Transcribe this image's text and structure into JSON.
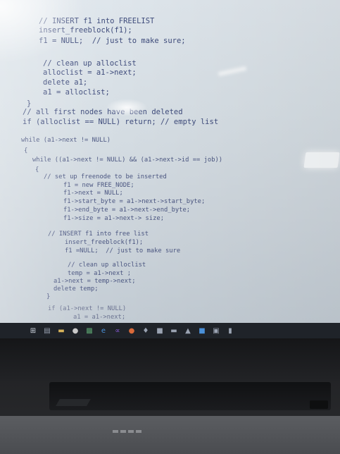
{
  "code_lines": [
    "// INSERT f1 into FREELIST",
    "insert_freeblock(f1);",
    "f1 = NULL;  // just to make sure;",
    "// clean up alloclist",
    "alloclist = a1->next;",
    "delete a1;",
    "a1 = alloclist;",
    "}",
    "// all first nodes have been deleted",
    "if (alloclist == NULL) return; // empty list",
    "while (a1->next != NULL)",
    "{",
    "while ((a1->next != NULL) && (a1->next->id == job))",
    "{",
    "// set up freenode to be inserted",
    "f1 = new FREE_NODE;",
    "f1->next = NULL;",
    "f1->start_byte = a1->next->start_byte;",
    "f1->end_byte = a1->next->end_byte;",
    "f1->size = a1->next-> size;",
    "// INSERT f1 into free list",
    "insert_freeblock(f1);",
    "f1 =NULL;  // just to make sure",
    "// clean up alloclist",
    "temp = a1->next ;",
    "a1->next = temp->next;",
    "delete temp;",
    "}",
    "if (a1->next != NULL)",
    "a1 = a1->next;"
  ],
  "taskbar": {
    "icons": [
      "windows-start-icon",
      "task-view-icon",
      "file-explorer-icon",
      "chrome-icon",
      "terminal-icon",
      "edge-icon",
      "visual-studio-icon",
      "app-icon",
      "app-icon",
      "app-icon",
      "app-icon",
      "app-icon",
      "app-icon",
      "app-icon",
      "app-icon"
    ],
    "colors": {
      "background": "#1f2329",
      "icon": "#9aa3b2"
    }
  },
  "colors": {
    "screen_bg": "#d7dfe5",
    "code_text": "#3e4b7b"
  }
}
